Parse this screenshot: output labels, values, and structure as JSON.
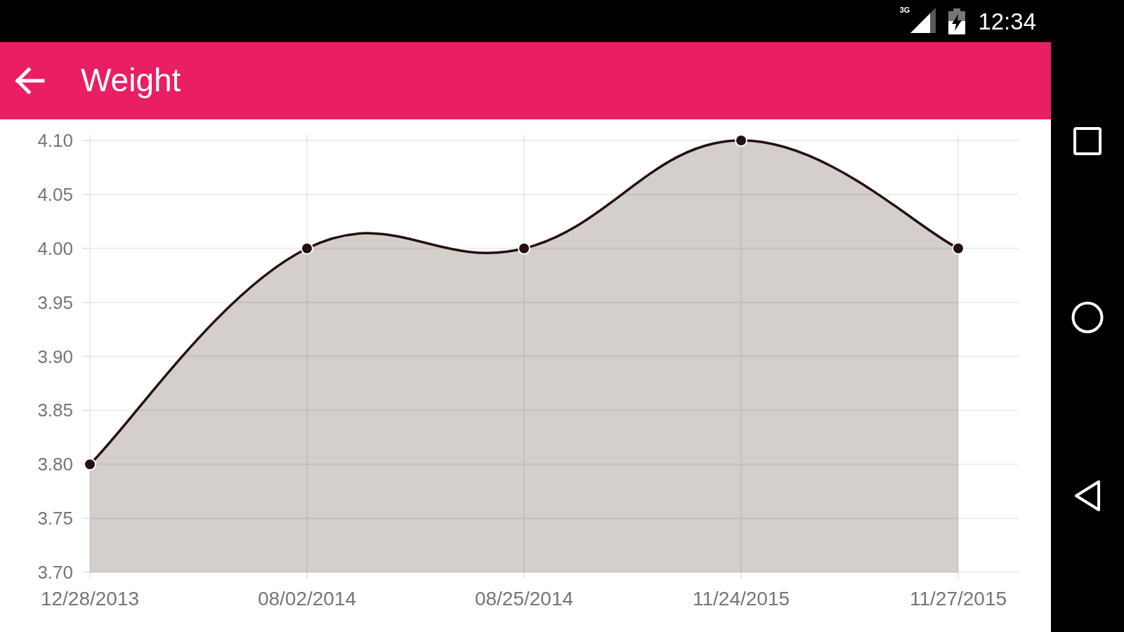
{
  "status_bar": {
    "network_type": "3G",
    "time": "12:34"
  },
  "app_bar": {
    "title": "Weight"
  },
  "chart": {
    "chart_data": {
      "type": "area",
      "categories": [
        "12/28/2013",
        "08/02/2014",
        "08/25/2014",
        "11/24/2015",
        "11/27/2015"
      ],
      "values": [
        3.8,
        4.0,
        4.0,
        4.1,
        4.0
      ],
      "color": "#d5cfcc",
      "ylim": [
        3.7,
        4.1
      ],
      "yticks": [
        {
          "value": 3.7,
          "label": "3.70"
        },
        {
          "value": 3.75,
          "label": "3.75"
        },
        {
          "value": 3.8,
          "label": "3.80"
        },
        {
          "value": 3.85,
          "label": "3.85"
        },
        {
          "value": 3.9,
          "label": "3.90"
        },
        {
          "value": 3.95,
          "label": "3.95"
        },
        {
          "value": 4.0,
          "label": "4.00"
        },
        {
          "value": 4.05,
          "label": "4.05"
        },
        {
          "value": 4.1,
          "label": "4.10"
        }
      ],
      "grid": true,
      "marker": "circle"
    }
  }
}
